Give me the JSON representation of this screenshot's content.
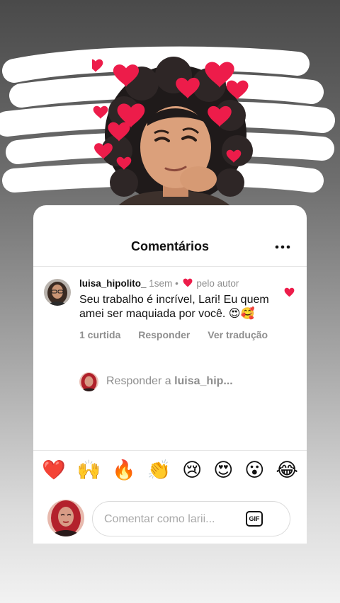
{
  "header": {
    "title": "Comentários"
  },
  "comment": {
    "username": "luisa_hipolito_",
    "time": "1sem",
    "separator": "•",
    "liked_by_author": "pelo autor",
    "text": "Seu trabalho é incrível, Lari! Eu quem amei ser maquiada por você. 😍🥰",
    "likes": "1 curtida",
    "reply_label": "Responder",
    "translate_label": "Ver tradução"
  },
  "reply": {
    "prefix": "Responder a ",
    "target": "luisa_hip..."
  },
  "emoji_bar": [
    "❤️",
    "🙌",
    "🔥",
    "👏",
    "😢",
    "😍",
    "😮",
    "😂"
  ],
  "composer": {
    "placeholder": "Comentar como larii...",
    "gif_label": "GIF"
  },
  "colors": {
    "heart": "#ed1c4a",
    "muted": "#8e8e8e",
    "background_top": "#4a4a4a"
  }
}
